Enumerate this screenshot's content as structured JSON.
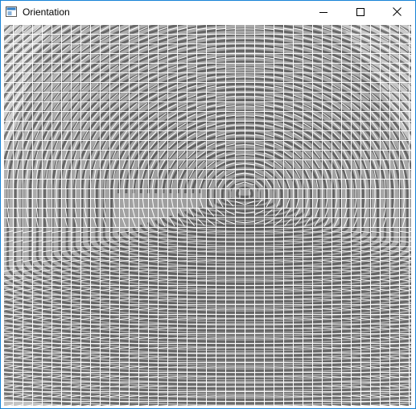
{
  "window": {
    "title": "Orientation",
    "icons": {
      "app": "window-app-icon",
      "minimize": "minimize-icon",
      "maximize": "maximize-icon",
      "close": "close-icon"
    }
  },
  "image": {
    "subject": "fingerprint",
    "overlay": "orientation-field-grid",
    "grid_color": "#ffffff",
    "line_color": "#ffffff",
    "background_tone": "#b5b5b5",
    "ridge_tone": "#2f2f2f"
  }
}
